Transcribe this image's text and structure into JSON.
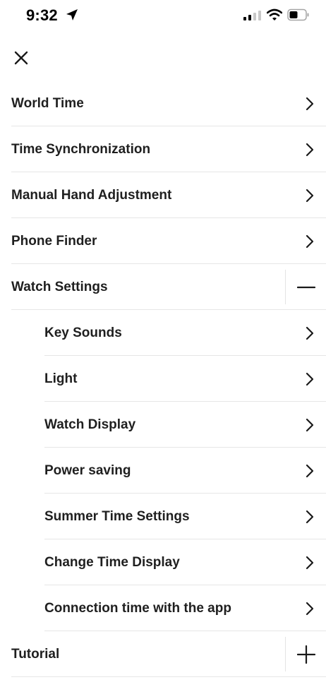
{
  "status_bar": {
    "time": "9:32"
  },
  "menu": {
    "items": [
      {
        "label": "World Time"
      },
      {
        "label": "Time Synchronization"
      },
      {
        "label": "Manual Hand Adjustment"
      },
      {
        "label": "Phone Finder"
      },
      {
        "label": "Watch Settings",
        "expanded": true,
        "children": [
          {
            "label": "Key Sounds"
          },
          {
            "label": "Light"
          },
          {
            "label": "Watch Display"
          },
          {
            "label": "Power saving"
          },
          {
            "label": "Summer Time Settings"
          },
          {
            "label": "Change Time Display"
          },
          {
            "label": "Connection time with the app"
          }
        ]
      },
      {
        "label": "Tutorial",
        "expanded": false
      }
    ]
  },
  "icons": {
    "close": "close-icon",
    "chevron": "chevron-right-icon",
    "collapse": "minus-icon",
    "expand": "plus-icon"
  }
}
